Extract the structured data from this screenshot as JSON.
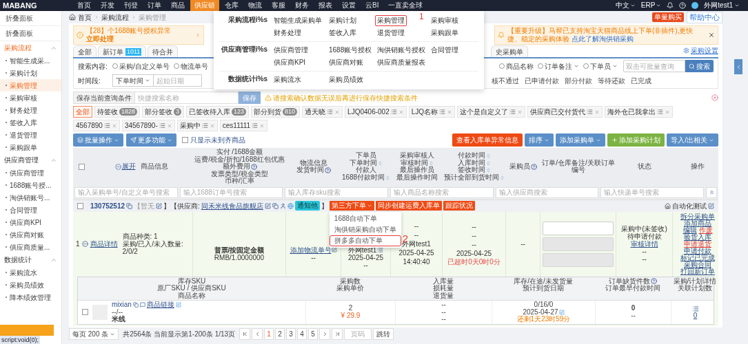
{
  "top_nav": {
    "logo": "MABANG",
    "items": [
      {
        "label": "首页",
        "selected": false
      },
      {
        "label": "开发",
        "selected": false
      },
      {
        "label": "刊登",
        "selected": false
      },
      {
        "label": "订单",
        "selected": false
      },
      {
        "label": "商品",
        "selected": false
      },
      {
        "label": "供应链",
        "selected": true
      },
      {
        "label": "仓库",
        "selected": false
      },
      {
        "label": "物流",
        "selected": false
      },
      {
        "label": "客服",
        "selected": false
      },
      {
        "label": "财务",
        "selected": false
      },
      {
        "label": "报表",
        "selected": false
      },
      {
        "label": "设置",
        "selected": false
      },
      {
        "label": "云BI",
        "selected": false
      },
      {
        "label": "一直卖全球",
        "selected": false
      }
    ],
    "right": [
      "中文",
      "ERP"
    ],
    "user": "外网test1"
  },
  "sidebar": {
    "collapse_items": [
      "折叠面板",
      "折叠面板"
    ],
    "groups": [
      {
        "title": "采购流程",
        "expanded": true,
        "selected": true,
        "items": [
          {
            "label": "智能生成采...",
            "selected": false
          },
          {
            "label": "采购计划",
            "selected": false
          },
          {
            "label": "采购管理",
            "selected": true
          },
          {
            "label": "采购审核",
            "selected": false
          },
          {
            "label": "财务处理",
            "selected": false
          },
          {
            "label": "签收入库",
            "selected": false
          },
          {
            "label": "退货管理",
            "selected": false
          },
          {
            "label": "采购跟单",
            "selected": false
          }
        ]
      },
      {
        "title": "供应商管理",
        "expanded": true,
        "selected": false,
        "items": [
          {
            "label": "供应商管理",
            "selected": false
          },
          {
            "label": "1688账号授...",
            "selected": false
          },
          {
            "label": "淘供销账号...",
            "selected": false
          },
          {
            "label": "合同管理",
            "selected": false
          },
          {
            "label": "供应商KPI",
            "selected": false
          },
          {
            "label": "供应商对账",
            "selected": false
          },
          {
            "label": "供应商质量...",
            "selected": false
          }
        ]
      },
      {
        "title": "数据统计",
        "expanded": true,
        "selected": false,
        "items": [
          {
            "label": "采购流水",
            "selected": false
          },
          {
            "label": "采购员绩效",
            "selected": false
          },
          {
            "label": "降本绩效管理",
            "selected": false
          }
        ]
      }
    ],
    "status_text": "script:void(0);"
  },
  "breadcrumb": [
    "首页",
    "采购流程",
    "采购管理"
  ],
  "header_buttons": [
    {
      "label": "单量购买",
      "kind": "badge"
    },
    {
      "label": "帮助中心",
      "kind": "link"
    }
  ],
  "alerts": [
    {
      "kind": "warning",
      "text": "【28】个1688账号授权异常",
      "action": "立即处理"
    },
    {
      "kind": "notice",
      "text": "【重要升级】马帮已支持淘宝天猫商品线上下单(非插件),更快捷、稳定的采购体验",
      "action": "点此了解淘供销采购"
    }
  ],
  "tabs": [
    {
      "label": "全部",
      "selected": false
    },
    {
      "label": "新订单",
      "count": "1011",
      "selected": false
    },
    {
      "label": "待合并",
      "selected": false
    },
    {
      "label": "史采购单",
      "selected": false
    }
  ],
  "settings_link": "采购设置",
  "search": {
    "label": "搜索内容:",
    "options": [
      {
        "label": "采购/自定义单号",
        "selected": false,
        "dropdown": false
      },
      {
        "label": "物流单号",
        "selected": false,
        "dropdown": false
      },
      {
        "label": "商品名称",
        "selected": false,
        "dropdown": false
      },
      {
        "label": "订单备注",
        "selected": false,
        "dropdown": true
      },
      {
        "label": "下单员",
        "selected": false,
        "dropdown": true
      }
    ],
    "placeholder": "双击可批量查询",
    "button": "搜索"
  },
  "time": {
    "label": "时间段:",
    "type": "下单时间",
    "placeholder": "起始日期",
    "statuses": [
      "核不通过",
      "已申请付款",
      "部分付款",
      "等待还款",
      "已完成"
    ]
  },
  "save_bar": {
    "button": "保存当前查询条件",
    "placeholder": "快捷搜索名称",
    "save": "保存",
    "hint": "请搜索确认数据无误后再进行保存快捷搜索条件"
  },
  "chips": [
    {
      "label": "全部",
      "selected": true,
      "removable": false
    },
    {
      "label": "待签收",
      "count": "1828",
      "selected": false,
      "removable": false
    },
    {
      "label": "部分签收",
      "count": "3",
      "selected": false,
      "removable": false
    },
    {
      "label": "已签收待入库",
      "count": "123",
      "selected": false,
      "removable": false
    },
    {
      "label": "部分到货",
      "count": "810",
      "selected": false,
      "removable": false
    },
    {
      "label": "通天晓",
      "selected": false,
      "removable": true
    },
    {
      "label": "LJQ0406-002",
      "selected": false,
      "removable": true
    },
    {
      "label": "LJQ名称",
      "selected": false,
      "removable": true
    },
    {
      "label": "这个是自定义了",
      "selected": false,
      "removable": true
    },
    {
      "label": "供应商已交付货代",
      "selected": false,
      "removable": true
    },
    {
      "label": "海外仓已我拿出",
      "selected": false,
      "removable": true
    },
    {
      "label": "4567890",
      "selected": false,
      "removable": true
    },
    {
      "label": "34567890-",
      "selected": false,
      "removable": true
    },
    {
      "label": "采购中",
      "selected": false,
      "removable": true
    },
    {
      "label": "ces11111",
      "selected": false,
      "removable": true
    }
  ],
  "left_actions": [
    "批量操作",
    "更多功能"
  ],
  "only_incomplete": {
    "label": "只显示未到齐商品",
    "checked": false
  },
  "right_actions": [
    {
      "label": "查看入库单异常信息",
      "kind": "danger"
    },
    {
      "label": "排序",
      "kind": "dropdown"
    },
    {
      "label": "添加采购单",
      "kind": "dropdown"
    },
    {
      "label": "添加采购计划",
      "kind": "add"
    },
    {
      "label": "导入/出相关",
      "kind": "dropdown"
    }
  ],
  "table": {
    "select_all": {
      "checked": false
    },
    "expand_link": "展开",
    "columns": [
      {
        "lines": [
          "商品信息"
        ]
      },
      {
        "lines": [
          "实付 /1688金额",
          "运费/税金/折扣/1688红包优惠",
          "额外费用",
          "发票类型/税金类型",
          "币种/汇率"
        ]
      },
      {
        "lines": [
          "物流信息",
          "发货时间"
        ]
      },
      {
        "lines": [
          "下单员",
          "下单时间",
          "付款人",
          "1688付款时间"
        ]
      },
      {
        "lines": [
          "采购审核人",
          "审核时间",
          "最后操作员",
          "最后操作时间"
        ]
      },
      {
        "lines": [
          "付款时间",
          "入库时间",
          "签收时间",
          "预计全部到货时间"
        ]
      },
      {
        "lines": [
          "采购员"
        ]
      },
      {
        "lines": [
          "订单/仓库备注/关联订单编号"
        ]
      },
      {
        "lines": [
          "状态"
        ]
      },
      {
        "lines": [
          "操作"
        ]
      }
    ],
    "filters": [
      "输入采购单号/自定义单号搜索",
      "输入1688订单号搜索",
      "输入库存sku搜索",
      "输入商品名称搜索",
      "输入供应商搜索",
      "输入快递单号搜索"
    ],
    "orders": [
      {
        "checked": false,
        "number": "130752512",
        "note": "【暂无",
        "supplier_label": "】【供应商:",
        "closing": "】",
        "supplier": "同禾米线食品旗舰店",
        "notify": "通知他",
        "actions": [
          "第三方下单",
          "同步创建运费入库单",
          "跟踪状况"
        ],
        "menu": {
          "open": true,
          "items": [
            {
              "label": "1688自动下单",
              "highlighted": false
            },
            {
              "label": "淘供销采购自动下单",
              "highlighted": false
            },
            {
              "label": "拼多多自动下单",
              "highlighted": true
            }
          ],
          "annotation": "2"
        },
        "tag": "自动化测试",
        "index": "1",
        "detail_link": "商品详情",
        "kinds": "商品种类: 1",
        "qty": "采购/已入/未入数量: 2/0/2",
        "amount": [
          "普票/按固定金额",
          "RMB/1.0000000"
        ],
        "logistics_link": "添加物流单号",
        "logistics": "--",
        "orderer": [
          "外网test1",
          "2025-04-25",
          "--"
        ],
        "audit": [
          "--",
          "--",
          "外网test1",
          "2025-04-25 14:40:40"
        ],
        "times": [
          "--",
          "--",
          "--",
          "2025-04-25"
        ],
        "overdue": "已超时0天0时0分",
        "buyer": "--",
        "remarks": [
          {
            "disabled": false
          },
          {
            "disabled": true
          },
          {
            "disabled": true
          }
        ],
        "status": [
          "采购中(未签收)",
          "待申请付款"
        ],
        "status_link": "审核详情",
        "status_extra": [
          "--",
          "--"
        ],
        "operations": [
          [
            {
              "label": "拆分采购单",
              "danger": false
            }
          ],
          [
            {
              "label": "添加商品",
              "danger": false
            }
          ],
          [
            {
              "label": "编辑",
              "danger": false
            },
            {
              "label": "作废",
              "danger": true
            }
          ],
          [
            {
              "label": "验货入库",
              "danger": false
            }
          ],
          [
            {
              "label": "申请退货",
              "danger": true
            }
          ],
          [
            {
              "label": "申请付款",
              "danger": false
            }
          ],
          [
            {
              "label": "标记已完成",
              "danger": false
            }
          ],
          [
            {
              "label": "采购合同",
              "danger": false
            }
          ],
          [
            {
              "label": "打回新订单",
              "danger": false
            }
          ]
        ],
        "items_header": [
          [
            "库存SKU",
            "原厂SKU / 供应商SKU",
            "商品名称"
          ],
          [
            "采购数",
            "采购单价"
          ],
          [
            "入库量",
            "损耗量",
            "退货量"
          ],
          [
            "库存/在途/未发货量",
            "预计到货日期"
          ],
          [
            "订单缺货件数",
            "订单最早付款时间"
          ],
          [
            "采购/计划详情",
            "关联计划数"
          ]
        ],
        "items": [
          {
            "checked": false,
            "sku": "mixian",
            "link": "商品链接",
            "sku2": "--/--",
            "name": "米线",
            "qty": "2",
            "price": "¥ 29.9",
            "received": [
              "--",
              "--",
              "--"
            ],
            "stock": "0/16/0",
            "eta": "2025-04-27",
            "remaining": "还剩1天23时59分",
            "shortage": "0",
            "earliest": "--",
            "plans": "0"
          }
        ]
      }
    ]
  },
  "pagination": {
    "page_size": "每页 200 条",
    "summary": "共2564条 当前显示第1-200条 1/13页",
    "pages": [
      {
        "label": "1",
        "selected": true
      },
      {
        "label": "2",
        "selected": false
      },
      {
        "label": "3",
        "selected": false
      },
      {
        "label": "4",
        "selected": false
      },
      {
        "label": "5",
        "selected": false
      }
    ],
    "placeholder": "页码",
    "go": "跳转"
  },
  "nav_menu": {
    "annotation": "1",
    "sections": [
      {
        "title": "采购流程i%s",
        "items": [
          {
            "label": "智能生成采购单",
            "highlighted": false
          },
          {
            "label": "采购计划",
            "highlighted": false
          },
          {
            "label": "采购管理",
            "highlighted": true
          },
          {
            "label": "采购审核",
            "highlighted": false
          },
          {
            "label": "财务处理",
            "highlighted": false
          },
          {
            "label": "签收入库",
            "highlighted": false
          },
          {
            "label": "退货管理",
            "highlighted": false
          },
          {
            "label": "采购跟单",
            "highlighted": false
          }
        ]
      },
      {
        "title": "供应商管理i%s",
        "items": [
          {
            "label": "供应商管理",
            "highlighted": false
          },
          {
            "label": "1688账号授权",
            "highlighted": false
          },
          {
            "label": "淘供销账号授权",
            "highlighted": false
          },
          {
            "label": "合同管理",
            "highlighted": false
          },
          {
            "label": "供应商KPI",
            "highlighted": false
          },
          {
            "label": "供应商对账",
            "highlighted": false
          },
          {
            "label": "供应商质量报表",
            "highlighted": false
          }
        ]
      },
      {
        "title": "数据统计i%s",
        "items": [
          {
            "label": "采购流水",
            "highlighted": false
          },
          {
            "label": "采购员绩效",
            "highlighted": false
          }
        ]
      }
    ]
  }
}
